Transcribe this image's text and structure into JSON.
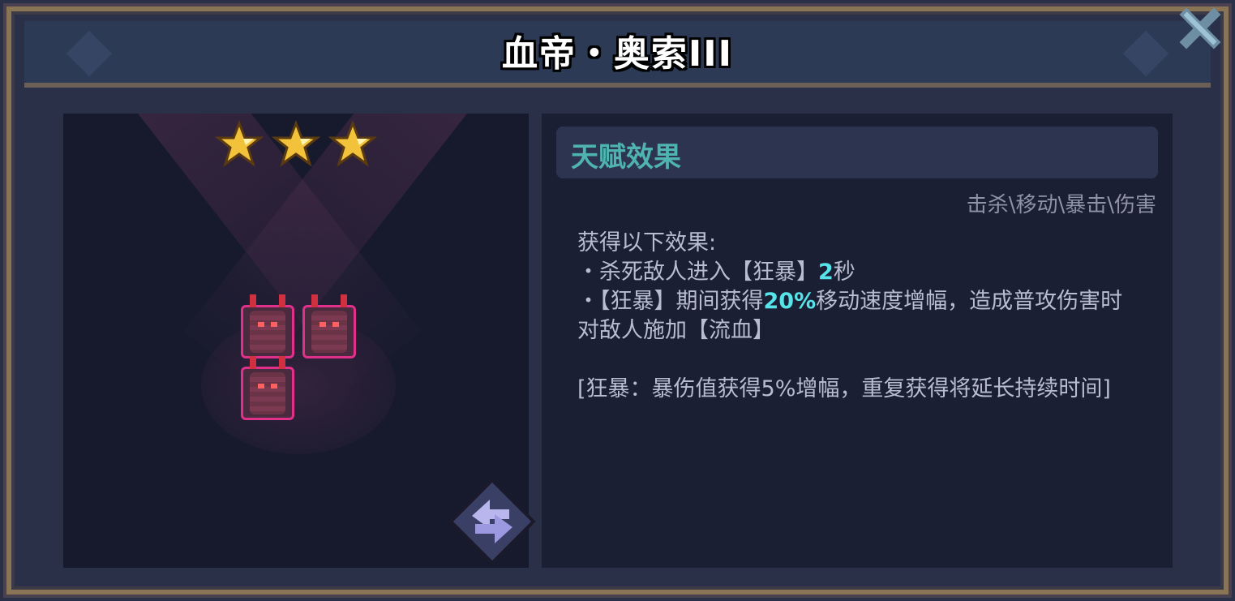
{
  "title": "血帝・奥索III",
  "stars": 3,
  "talent": {
    "header": "天赋效果",
    "tags": "击杀\\移动\\暴击\\伤害",
    "intro": "获得以下效果:",
    "line1_prefix": "・杀死敌人进入【狂暴】",
    "line1_value": "2",
    "line1_suffix": "秒",
    "line2_prefix": "・【狂暴】期间获得",
    "line2_value": "20%",
    "line2_suffix": "移动速度增幅，造成普攻伤害时对敌人施加【流血】",
    "note": "[狂暴：暴伤值获得5%增幅，重复获得将延长持续时间]"
  },
  "units": [
    "unit-1",
    "unit-2",
    "unit-3"
  ],
  "colors": {
    "accent_teal": "#4fb3b0",
    "highlight": "#56e4e8",
    "unit_border": "#e0308a"
  }
}
